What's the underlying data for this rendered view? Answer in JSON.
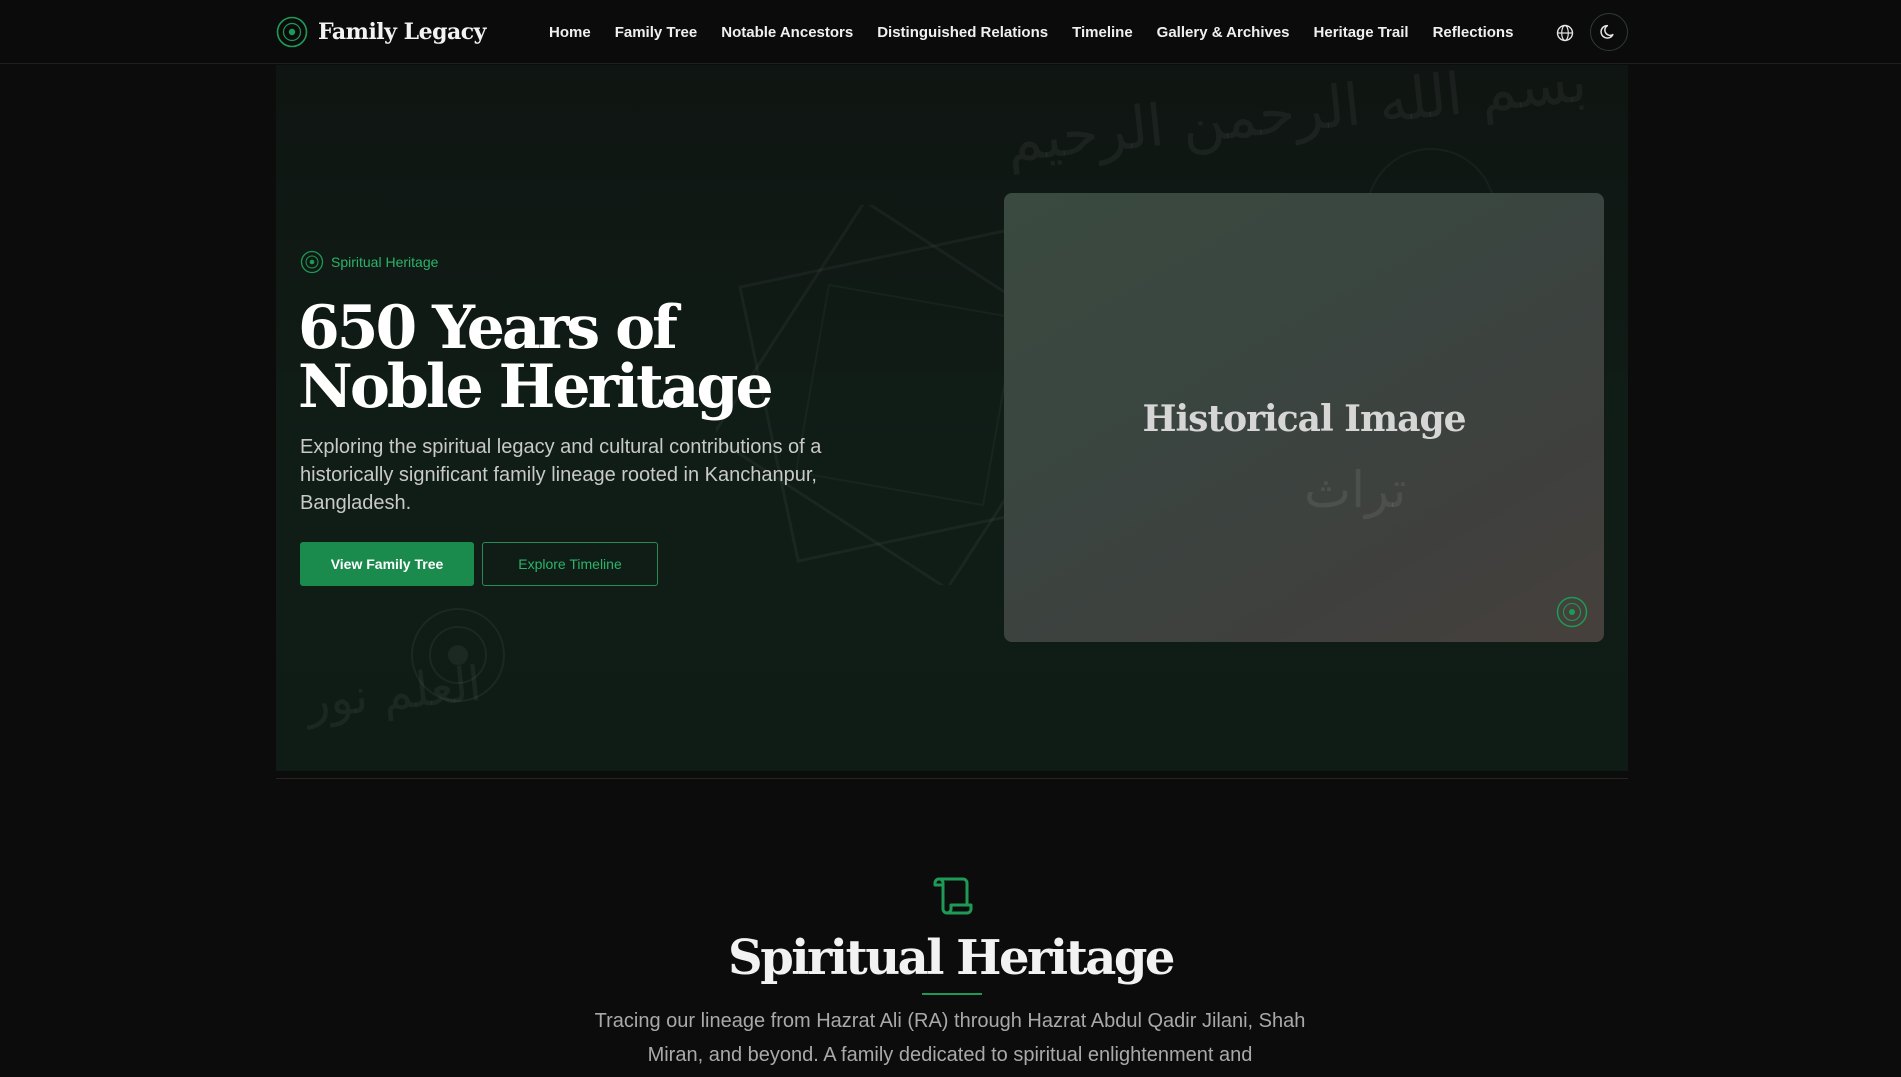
{
  "header": {
    "brand": "Family Legacy",
    "nav": [
      {
        "label": "Home"
      },
      {
        "label": "Family Tree"
      },
      {
        "label": "Notable Ancestors"
      },
      {
        "label": "Distinguished Relations"
      },
      {
        "label": "Timeline"
      },
      {
        "label": "Gallery & Archives"
      },
      {
        "label": "Heritage Trail"
      },
      {
        "label": "Reflections"
      }
    ],
    "icons": {
      "language": "globe-icon",
      "theme": "moon-icon"
    }
  },
  "hero": {
    "eyebrow": "Spiritual Heritage",
    "title": "650 Years of Noble Heritage",
    "description": "Exploring the spiritual legacy and cultural contributions of a historically significant family lineage rooted in Kanchanpur, Bangladesh.",
    "primary_button": "View Family Tree",
    "secondary_button": "Explore Timeline",
    "image_card": {
      "title": "Historical Image",
      "arabic": "تراث"
    },
    "decorative_calligraphy": {
      "top": "بسم الله الرحمن الرحيم",
      "bottom": "العلم نور"
    }
  },
  "section": {
    "icon": "scroll-icon",
    "title": "Spiritual Heritage",
    "description": "Tracing our lineage from Hazrat Ali (RA) through Hazrat Abdul Qadir Jilani, Shah Miran, and beyond. A family dedicated to spiritual enlightenment and"
  },
  "colors": {
    "accent": "#1a8a4d",
    "accent_text": "#2bb36a",
    "background": "#0c0c0c",
    "hero_bg": "#0f1a15"
  }
}
